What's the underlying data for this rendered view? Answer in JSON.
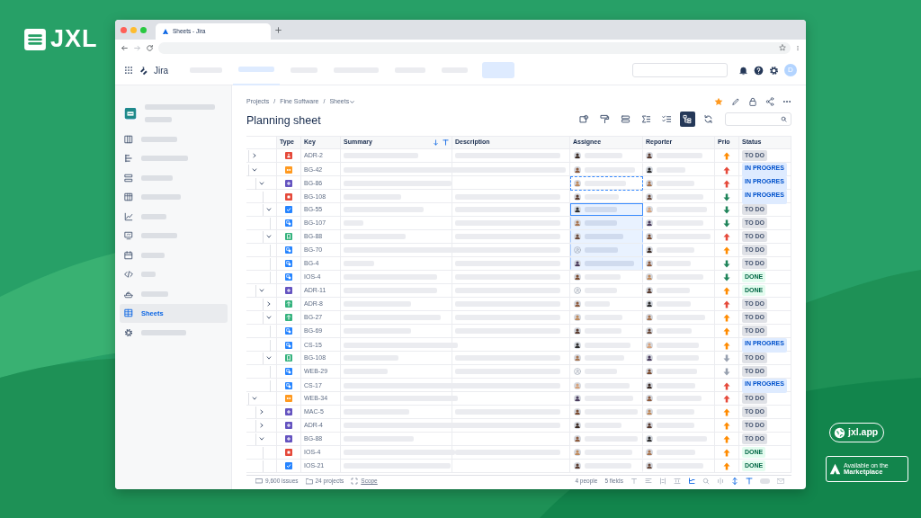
{
  "logo": {
    "text": "JXL"
  },
  "browser": {
    "tab_title": "Sheets - Jira"
  },
  "app": {
    "name": "Jira",
    "user_initial": "D"
  },
  "sidebar": {
    "items": [
      {
        "selected": false
      },
      {
        "selected": false
      },
      {
        "selected": false
      },
      {
        "selected": false
      },
      {
        "selected": false
      },
      {
        "selected": false
      },
      {
        "selected": false
      },
      {
        "selected": false
      },
      {
        "selected": false
      },
      {
        "selected": false
      },
      {
        "label": "Sheets",
        "selected": true
      },
      {
        "selected": false
      }
    ]
  },
  "breadcrumb": {
    "items": [
      "Projects",
      "Fine Software",
      "Sheets"
    ],
    "separator": "/"
  },
  "title": "Planning sheet",
  "starred": true,
  "toolbar": [
    {
      "selected": false
    },
    {
      "selected": false
    },
    {
      "selected": false
    },
    {
      "selected": false
    },
    {
      "selected": false
    },
    {
      "selected": true
    },
    {
      "selected": false
    }
  ],
  "columns": [
    "Type",
    "Key",
    "Summary",
    "Description",
    "Assignee",
    "Reporter",
    "Prio",
    "Status"
  ],
  "rows": [
    {
      "key": "ADR-2",
      "kind": "bug",
      "expanded": false,
      "has_description": true,
      "assignee": {
        "unassigned": false,
        "selected": false,
        "focused": false,
        "copied": false
      },
      "arrow": {
        "up": true,
        "color": "#ff8b00"
      },
      "status": {
        "label": "TO DO",
        "kind": "todo"
      }
    },
    {
      "key": "BG-42",
      "kind": "epic",
      "expanded": true,
      "has_description": true,
      "assignee": {
        "unassigned": false,
        "selected": false,
        "focused": false,
        "copied": false
      },
      "arrow": {
        "up": true,
        "color": "#e5493a"
      },
      "status": {
        "label": "IN PROGRES",
        "kind": "progress"
      },
      "children": [
        {
          "key": "BG-86",
          "kind": "feature",
          "expanded": true,
          "has_description": false,
          "assignee": {
            "unassigned": false,
            "selected": false,
            "focused": false,
            "copied": true
          },
          "arrow": {
            "up": true,
            "color": "#e5493a"
          },
          "status": {
            "label": "IN PROGRES",
            "kind": "progress"
          },
          "children": [
            {
              "key": "BG-108",
              "kind": "blocker",
              "has_description": true,
              "assignee": {
                "unassigned": false,
                "selected": false,
                "focused": false,
                "copied": false
              },
              "arrow": {
                "up": false,
                "color": "#1f845a"
              },
              "status": {
                "label": "IN PROGRES",
                "kind": "progress"
              }
            },
            {
              "key": "BG-55",
              "kind": "task",
              "expanded": true,
              "has_description": true,
              "assignee": {
                "unassigned": false,
                "selected": true,
                "focused": true,
                "copied": false
              },
              "arrow": {
                "up": false,
                "color": "#1f845a"
              },
              "status": {
                "label": "TO DO",
                "kind": "todo"
              },
              "children": [
                {
                  "key": "BG-107",
                  "kind": "subtask",
                  "has_description": true,
                  "assignee": {
                    "unassigned": false,
                    "selected": true,
                    "focused": false,
                    "copied": false
                  },
                  "arrow": {
                    "up": false,
                    "color": "#1f845a"
                  },
                  "status": {
                    "label": "TO DO",
                    "kind": "todo"
                  }
                }
              ]
            },
            {
              "key": "BG-88",
              "kind": "story",
              "expanded": true,
              "has_description": true,
              "assignee": {
                "unassigned": false,
                "selected": true,
                "focused": false,
                "copied": false
              },
              "arrow": {
                "up": true,
                "color": "#e5493a"
              },
              "status": {
                "label": "TO DO",
                "kind": "todo"
              },
              "children": [
                {
                  "key": "BG-70",
                  "kind": "subtask",
                  "has_description": true,
                  "assignee": {
                    "unassigned": true,
                    "selected": true,
                    "focused": false,
                    "copied": false
                  },
                  "arrow": {
                    "up": true,
                    "color": "#ff8b00"
                  },
                  "status": {
                    "label": "TO DO",
                    "kind": "todo"
                  }
                },
                {
                  "key": "BG-4",
                  "kind": "subtask",
                  "has_description": true,
                  "assignee": {
                    "unassigned": false,
                    "selected": true,
                    "focused": false,
                    "copied": false
                  },
                  "arrow": {
                    "up": false,
                    "color": "#1f845a"
                  },
                  "status": {
                    "label": "TO DO",
                    "kind": "todo"
                  }
                },
                {
                  "key": "IOS-4",
                  "kind": "subtask",
                  "has_description": true,
                  "assignee": {
                    "unassigned": false,
                    "selected": false,
                    "focused": false,
                    "copied": false
                  },
                  "arrow": {
                    "up": false,
                    "color": "#1f845a"
                  },
                  "status": {
                    "label": "DONE",
                    "kind": "done"
                  }
                }
              ]
            }
          ]
        },
        {
          "key": "ADR-11",
          "kind": "feature",
          "expanded": true,
          "has_description": true,
          "assignee": {
            "unassigned": true,
            "selected": false,
            "focused": false,
            "copied": false
          },
          "arrow": {
            "up": true,
            "color": "#ff8b00"
          },
          "status": {
            "label": "DONE",
            "kind": "done"
          },
          "children": [
            {
              "key": "ADR-8",
              "kind": "improvement",
              "expanded": false,
              "has_description": true,
              "assignee": {
                "unassigned": false,
                "selected": false,
                "focused": false,
                "copied": false
              },
              "arrow": {
                "up": true,
                "color": "#e5493a"
              },
              "status": {
                "label": "TO DO",
                "kind": "todo"
              }
            },
            {
              "key": "BG-27",
              "kind": "improvement",
              "expanded": true,
              "has_description": true,
              "assignee": {
                "unassigned": false,
                "selected": false,
                "focused": false,
                "copied": false
              },
              "arrow": {
                "up": true,
                "color": "#ff8b00"
              },
              "status": {
                "label": "TO DO",
                "kind": "todo"
              },
              "children": [
                {
                  "key": "BG-69",
                  "kind": "subtask",
                  "has_description": true,
                  "assignee": {
                    "unassigned": false,
                    "selected": false,
                    "focused": false,
                    "copied": false
                  },
                  "arrow": {
                    "up": true,
                    "color": "#ff8b00"
                  },
                  "status": {
                    "label": "TO DO",
                    "kind": "todo"
                  }
                },
                {
                  "key": "CS-15",
                  "kind": "subtask",
                  "has_description": false,
                  "assignee": {
                    "unassigned": false,
                    "selected": false,
                    "focused": false,
                    "copied": false
                  },
                  "arrow": {
                    "up": true,
                    "color": "#ff8b00"
                  },
                  "status": {
                    "label": "IN PROGRES",
                    "kind": "progress"
                  }
                }
              ]
            },
            {
              "key": "BG-108",
              "kind": "story",
              "expanded": true,
              "has_description": true,
              "assignee": {
                "unassigned": false,
                "selected": false,
                "focused": false,
                "copied": false
              },
              "arrow": {
                "up": false,
                "color": "#97a0af"
              },
              "status": {
                "label": "TO DO",
                "kind": "todo"
              },
              "children": [
                {
                  "key": "WEB-29",
                  "kind": "subtask",
                  "has_description": true,
                  "assignee": {
                    "unassigned": true,
                    "selected": false,
                    "focused": false,
                    "copied": false
                  },
                  "arrow": {
                    "up": false,
                    "color": "#97a0af"
                  },
                  "status": {
                    "label": "TO DO",
                    "kind": "todo"
                  }
                },
                {
                  "key": "CS-17",
                  "kind": "subtask",
                  "has_description": true,
                  "assignee": {
                    "unassigned": false,
                    "selected": false,
                    "focused": false,
                    "copied": false
                  },
                  "arrow": {
                    "up": true,
                    "color": "#e5493a"
                  },
                  "status": {
                    "label": "IN PROGRES",
                    "kind": "progress"
                  }
                }
              ]
            }
          ]
        }
      ]
    },
    {
      "key": "WEB-34",
      "kind": "epic",
      "expanded": true,
      "has_description": false,
      "assignee": {
        "unassigned": false,
        "selected": false,
        "focused": false,
        "copied": false
      },
      "arrow": {
        "up": true,
        "color": "#e5493a"
      },
      "status": {
        "label": "TO DO",
        "kind": "todo"
      },
      "children": [
        {
          "key": "MAC-5",
          "kind": "feature",
          "expanded": false,
          "has_description": true,
          "assignee": {
            "unassigned": false,
            "selected": false,
            "focused": false,
            "copied": false
          },
          "arrow": {
            "up": true,
            "color": "#ff8b00"
          },
          "status": {
            "label": "TO DO",
            "kind": "todo"
          }
        },
        {
          "key": "ADR-4",
          "kind": "feature",
          "expanded": false,
          "has_description": true,
          "assignee": {
            "unassigned": false,
            "selected": false,
            "focused": false,
            "copied": false
          },
          "arrow": {
            "up": true,
            "color": "#ff8b00"
          },
          "status": {
            "label": "TO DO",
            "kind": "todo"
          }
        },
        {
          "key": "BG-88",
          "kind": "feature",
          "expanded": true,
          "has_description": false,
          "assignee": {
            "unassigned": false,
            "selected": false,
            "focused": false,
            "copied": false
          },
          "arrow": {
            "up": true,
            "color": "#ff8b00"
          },
          "status": {
            "label": "TO DO",
            "kind": "todo"
          },
          "children": [
            {
              "key": "IOS-4",
              "kind": "blocker",
              "has_description": true,
              "assignee": {
                "unassigned": false,
                "selected": false,
                "focused": false,
                "copied": false
              },
              "arrow": {
                "up": true,
                "color": "#ff8b00"
              },
              "status": {
                "label": "DONE",
                "kind": "done"
              }
            },
            {
              "key": "IOS-21",
              "kind": "task",
              "has_description": false,
              "assignee": {
                "unassigned": false,
                "selected": false,
                "focused": false,
                "copied": false
              },
              "arrow": {
                "up": true,
                "color": "#ff8b00"
              },
              "status": {
                "label": "DONE",
                "kind": "done"
              }
            }
          ]
        }
      ]
    }
  ],
  "footer": {
    "issues": "9,600 issues",
    "projects": "24 projects",
    "scope": "Scope",
    "people": "4 people",
    "fields": "5 fields",
    "tools": [
      {
        "on": false
      },
      {
        "on": false
      },
      {
        "on": false
      },
      {
        "on": false
      },
      {
        "on": true
      },
      {
        "on": false
      },
      {
        "on": false
      },
      {
        "on": true
      },
      {
        "on": true
      }
    ],
    "toggle_on": false
  },
  "badges": {
    "site": "jxl.app",
    "marketplace_top": "Available on the",
    "marketplace": "Marketplace"
  }
}
